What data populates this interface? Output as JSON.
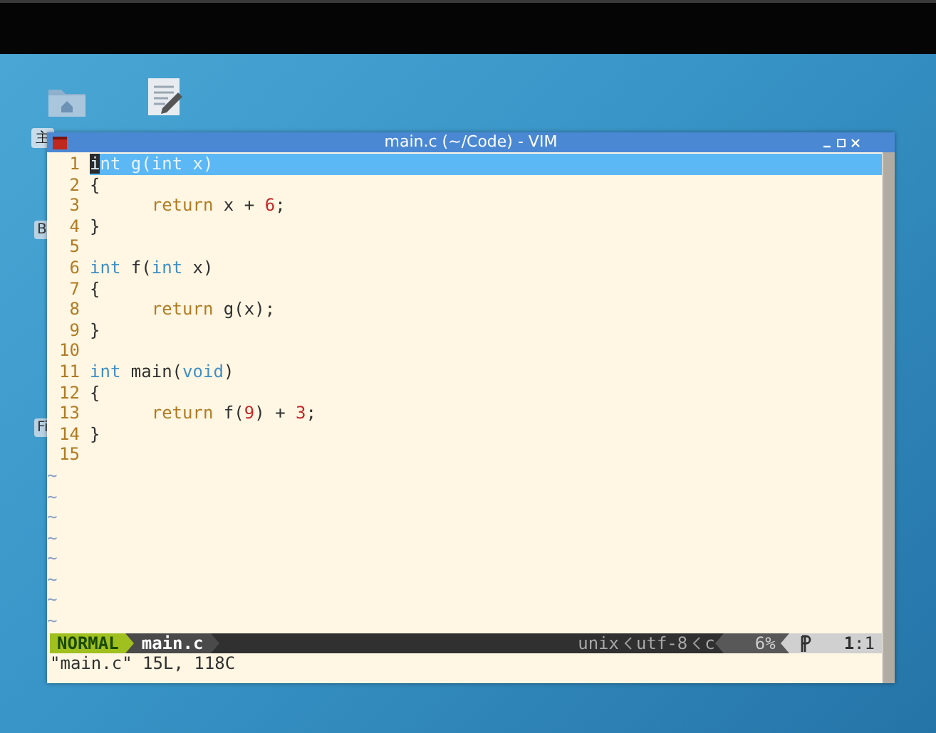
{
  "desktop": {
    "icons": [
      {
        "kind": "folder",
        "label": "主"
      },
      {
        "kind": "editor"
      }
    ],
    "label_fragments": [
      "B",
      "Fi"
    ]
  },
  "window": {
    "title": "main.c (~/Code) - VIM",
    "lines": [
      {
        "number": "1",
        "current": true,
        "tokens": [
          {
            "kind": "type",
            "text": "int"
          },
          {
            "kind": "plain",
            "text": " g("
          },
          {
            "kind": "type",
            "text": "int"
          },
          {
            "kind": "plain",
            "text": " x)"
          }
        ]
      },
      {
        "number": "2",
        "current": false,
        "tokens": [
          {
            "kind": "plain",
            "text": "{"
          }
        ]
      },
      {
        "number": "3",
        "current": false,
        "indented": true,
        "tokens": [
          {
            "kind": "keyword",
            "text": "return"
          },
          {
            "kind": "plain",
            "text": " x + "
          },
          {
            "kind": "number",
            "text": "6"
          },
          {
            "kind": "plain",
            "text": ";"
          }
        ]
      },
      {
        "number": "4",
        "current": false,
        "tokens": [
          {
            "kind": "plain",
            "text": "}"
          }
        ]
      },
      {
        "number": "5",
        "current": false
      },
      {
        "number": "6",
        "current": false,
        "tokens": [
          {
            "kind": "type",
            "text": "int"
          },
          {
            "kind": "plain",
            "text": " f("
          },
          {
            "kind": "type",
            "text": "int"
          },
          {
            "kind": "plain",
            "text": " x)"
          }
        ]
      },
      {
        "number": "7",
        "current": false,
        "tokens": [
          {
            "kind": "plain",
            "text": "{"
          }
        ]
      },
      {
        "number": "8",
        "current": false,
        "indented": true,
        "tokens": [
          {
            "kind": "keyword",
            "text": "return"
          },
          {
            "kind": "plain",
            "text": " g(x);"
          }
        ]
      },
      {
        "number": "9",
        "current": false,
        "tokens": [
          {
            "kind": "plain",
            "text": "}"
          }
        ]
      },
      {
        "number": "10",
        "current": false
      },
      {
        "number": "11",
        "current": false,
        "tokens": [
          {
            "kind": "type",
            "text": "int"
          },
          {
            "kind": "plain",
            "text": " main("
          },
          {
            "kind": "type",
            "text": "void"
          },
          {
            "kind": "plain",
            "text": ")"
          }
        ]
      },
      {
        "number": "12",
        "current": false,
        "tokens": [
          {
            "kind": "plain",
            "text": "{"
          }
        ]
      },
      {
        "number": "13",
        "current": false,
        "indented": true,
        "tokens": [
          {
            "kind": "keyword",
            "text": "return"
          },
          {
            "kind": "plain",
            "text": " f("
          },
          {
            "kind": "number",
            "text": "9"
          },
          {
            "kind": "plain",
            "text": ") + "
          },
          {
            "kind": "number",
            "text": "3"
          },
          {
            "kind": "plain",
            "text": ";"
          }
        ]
      },
      {
        "number": "14",
        "current": false,
        "tokens": [
          {
            "kind": "plain",
            "text": "}"
          }
        ]
      },
      {
        "number": "15",
        "current": false
      }
    ],
    "filler_lines": [
      "~",
      "~",
      "~",
      "~",
      "~",
      "~",
      "~",
      "~"
    ],
    "status_line": {
      "mode": "NORMAL",
      "file": "main.c",
      "fileformat": "unix",
      "encoding": "utf-8",
      "filetype": "c",
      "percent": "6%",
      "position": "**1**:1"
    },
    "command_line": "\"main.c\" 15L, 118C"
  }
}
